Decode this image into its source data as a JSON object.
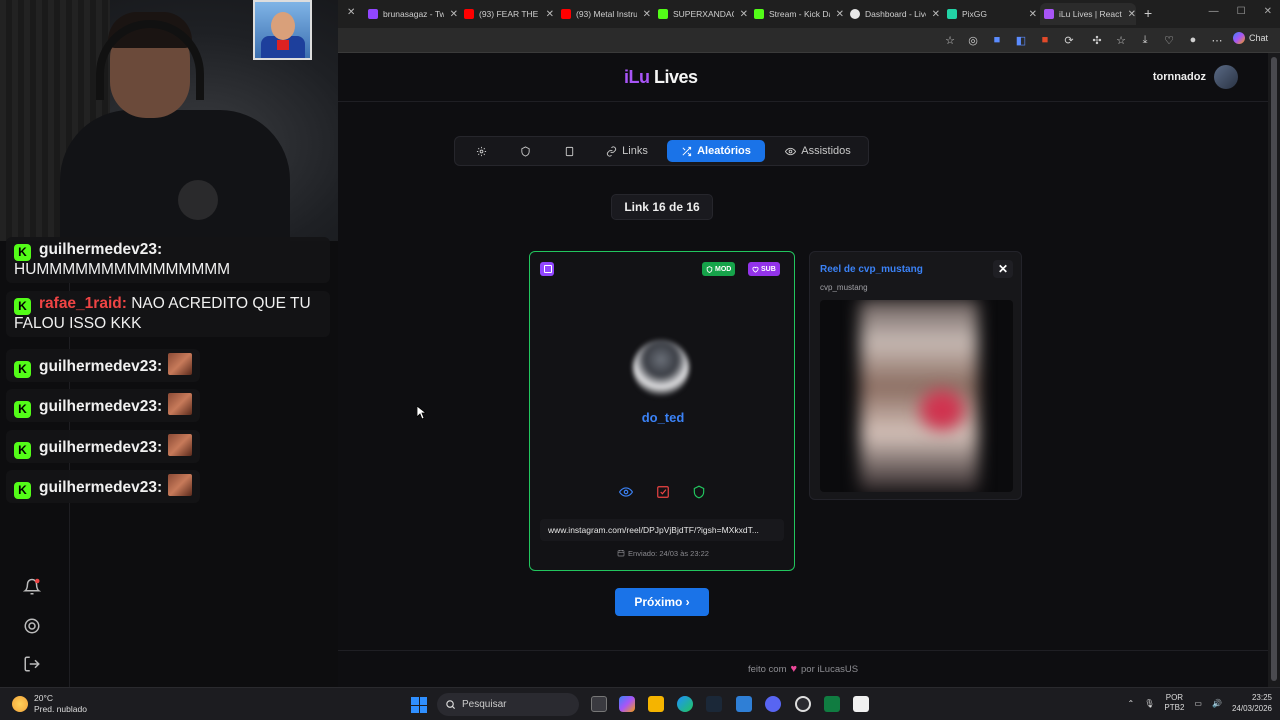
{
  "browser": {
    "tabs": [
      {
        "title": "brunasagaz - Tw",
        "favicon_color": "#9146ff"
      },
      {
        "title": "(93) FEAR THE C",
        "favicon_color": "#ff0000"
      },
      {
        "title": "(93) Metal Instru",
        "favicon_color": "#ff0000"
      },
      {
        "title": "SUPERXANDAO",
        "favicon_color": "#53fc18"
      },
      {
        "title": "Stream - Kick Da",
        "favicon_color": "#53fc18"
      },
      {
        "title": "Dashboard - Live",
        "favicon_color": "#e6e6e6"
      },
      {
        "title": "PixGG",
        "favicon_color": "#22d3a6"
      },
      {
        "title": "iLu Lives | React",
        "favicon_color": "#a855f7"
      }
    ],
    "chat_label": "Chat"
  },
  "overlay": {
    "chat": [
      {
        "user": "guilhermedev23:",
        "text": "HUMMMMMMMMMMMMMMM",
        "user_color": "#f0f0f0"
      },
      {
        "user": "rafae_1raid:",
        "text": "NAO ACREDITO QUE TU FALOU ISSO KKK",
        "user_color": "#ef4444"
      },
      {
        "user": "guilhermedev23:",
        "text": "",
        "user_color": "#f0f0f0"
      },
      {
        "user": "guilhermedev23:",
        "text": "",
        "user_color": "#f0f0f0"
      },
      {
        "user": "guilhermedev23:",
        "text": "",
        "user_color": "#f0f0f0"
      },
      {
        "user": "guilhermedev23:",
        "text": "",
        "user_color": "#f0f0f0"
      }
    ],
    "kick_glyph": "K"
  },
  "app": {
    "logo_ilu": "iLu",
    "logo_lives": "Lives",
    "username": "tornnadoz",
    "nav": {
      "links": "Links",
      "aleatorios": "Aleatórios",
      "assistidos": "Assistidos"
    },
    "counter": "Link 16 de 16",
    "card": {
      "badge_mod": "MOD",
      "badge_sub": "SUB",
      "user": "do_ted",
      "url": "www.instagram.com/reel/DPJpVjBjdTF/?igsh=MXkxdT...",
      "sent": "Enviado: 24/03 às 23:22"
    },
    "side_card": {
      "title": "Reel de cvp_mustang",
      "subtitle": "cvp_mustang",
      "close": "✕"
    },
    "next_button": "Próximo ›",
    "footer": {
      "before": "feito com",
      "heart": "♥",
      "after": "por iLucasUS"
    }
  },
  "taskbar": {
    "temp": "20°C",
    "weather": "Pred. nublado",
    "search_placeholder": "Pesquisar",
    "lang_1": "POR",
    "lang_2": "PTB2",
    "time": "23:25",
    "date": "24/03/2026"
  }
}
